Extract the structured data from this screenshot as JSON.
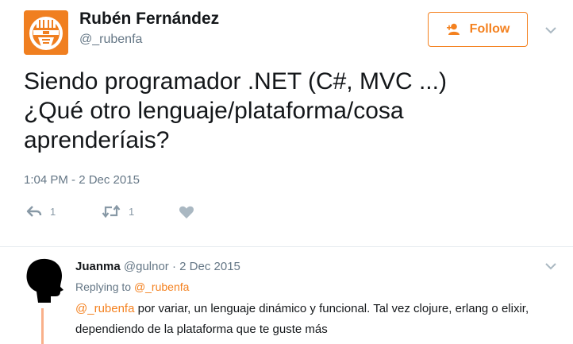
{
  "tweet": {
    "author_name": "Rubén Fernández",
    "author_handle": "@_rubenfa",
    "follow_label": "Follow",
    "text": "Siendo programador .NET (C#, MVC ...)\n¿Qué otro lenguaje/plataforma/cosa\naprenderíais?",
    "timestamp": "1:04 PM - 2 Dec 2015",
    "actions": {
      "reply_count": "1",
      "retweet_count": "1"
    }
  },
  "reply": {
    "author_name": "Juanma",
    "author_handle": "@gulnor",
    "separator": "·",
    "date": "2 Dec 2015",
    "replying_prefix": "Replying to",
    "replying_to": "@_rubenfa",
    "mention": "@_rubenfa",
    "text": " por variar, un lenguaje dinámico y funcional. Tal vez clojure, erlang o elixir, dependiendo de la plataforma que te guste más"
  },
  "colors": {
    "accent": "#f4811f",
    "avatar_bg": "#f07f20",
    "secondary_text": "#657786",
    "icon_gray": "#8899a6",
    "thread_line": "#f9b08a"
  },
  "icons": {
    "avatar_main": "cylon-helmet-logo",
    "follow": "add-user-icon",
    "caret": "chevron-down-icon",
    "reply": "reply-icon",
    "retweet": "retweet-icon",
    "like": "heart-icon",
    "reply_avatar": "silhouette-avatar"
  }
}
